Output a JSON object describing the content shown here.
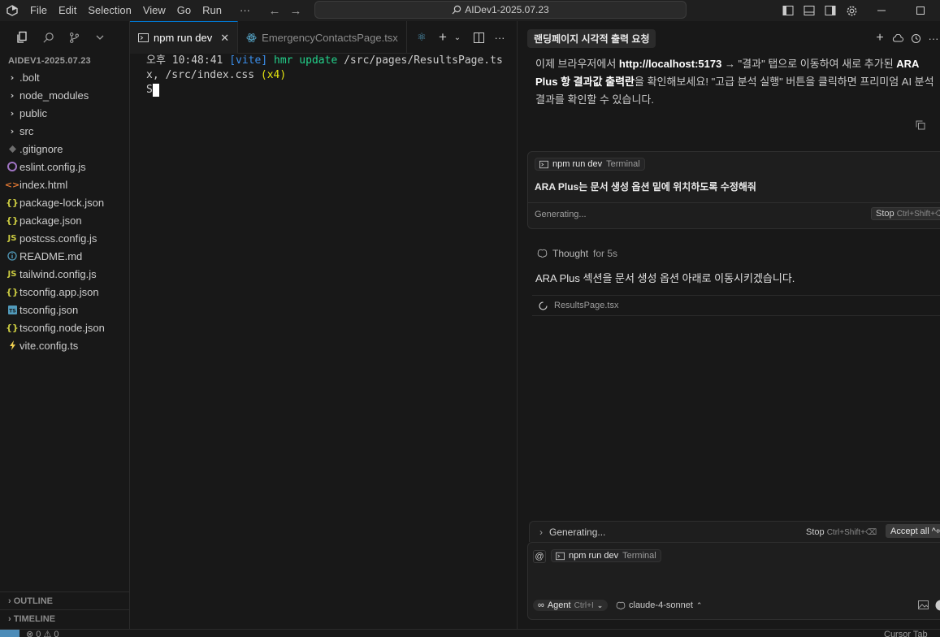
{
  "titlebar": {
    "menus": [
      "File",
      "Edit",
      "Selection",
      "View",
      "Go",
      "Run",
      "···"
    ],
    "search_text": "AIDev1-2025.07.23"
  },
  "explorer": {
    "title": "AIDEV1-2025.07.23",
    "items": [
      {
        "label": ".bolt",
        "icon": "chevron",
        "color": "#cccccc"
      },
      {
        "label": "node_modules",
        "icon": "chevron",
        "color": "#cccccc"
      },
      {
        "label": "public",
        "icon": "chevron",
        "color": "#cccccc"
      },
      {
        "label": "src",
        "icon": "chevron",
        "color": "#cccccc"
      },
      {
        "label": ".gitignore",
        "icon": "git-diamond",
        "color": "#6d6d6d"
      },
      {
        "label": "eslint.config.js",
        "icon": "eslint-circle",
        "color": "#a074c4"
      },
      {
        "label": "index.html",
        "icon": "html-brackets",
        "color": "#e37933"
      },
      {
        "label": "package-lock.json",
        "icon": "json-braces",
        "color": "#cbcb41"
      },
      {
        "label": "package.json",
        "icon": "json-braces",
        "color": "#cbcb41"
      },
      {
        "label": "postcss.config.js",
        "icon": "js-text",
        "color": "#cbcb41"
      },
      {
        "label": "README.md",
        "icon": "info-circle",
        "color": "#519aba"
      },
      {
        "label": "tailwind.config.js",
        "icon": "js-text",
        "color": "#cbcb41"
      },
      {
        "label": "tsconfig.app.json",
        "icon": "json-braces",
        "color": "#cbcb41"
      },
      {
        "label": "tsconfig.json",
        "icon": "ts-square",
        "color": "#519aba"
      },
      {
        "label": "tsconfig.node.json",
        "icon": "json-braces",
        "color": "#cbcb41"
      },
      {
        "label": "vite.config.ts",
        "icon": "vite-bolt",
        "color": "#f0d050"
      }
    ],
    "outline_label": "OUTLINE",
    "timeline_label": "TIMELINE"
  },
  "editor": {
    "tabs": [
      {
        "label": "npm run dev",
        "active": true
      },
      {
        "label": "EmergencyContactsPage.tsx",
        "active": false
      }
    ],
    "terminal": {
      "time": "오후 10:48:41",
      "vite": "[vite]",
      "hmr": "hmr update",
      "path": "/src/pages/ResultsPage.tsx, /src/index.css",
      "count": "(x4)",
      "input_char": "S"
    }
  },
  "chat": {
    "title": "랜딩페이지 시각적 출력 요청",
    "message": {
      "part1": "이제 브라우저에서 ",
      "url": "http://localhost:5173",
      "part2": " → \"결과\" 탭으로 이동하여 새로 추가된 ",
      "bold2": "ARA Plus 항 결과값 출력란",
      "part3": "을 확인해보세요! \"고급 분석 실행\" 버튼을 클릭하면 프리미엄 AI 분석 결과를 확인할 수 있습니다."
    },
    "tool_card": {
      "chip_label": "npm run dev",
      "chip_sub": "Terminal",
      "instruction": "ARA Plus는 문서 생성 옵션 밑에 위치하도록 수정해줘",
      "status": "Generating...",
      "stop_label": "Stop",
      "stop_kbd": "Ctrl+Shift+⌫"
    },
    "thought": {
      "label": "Thought",
      "duration": "for 5s"
    },
    "reply": "ARA Plus 섹션을 문서 생성 옵션 아래로 이동시키겠습니다.",
    "file_row": "ResultsPage.tsx",
    "gen_bar": {
      "status": "Generating...",
      "stop_label": "Stop",
      "stop_kbd": "Ctrl+Shift+⌫",
      "accept_label": "Accept all",
      "accept_kbd": "^⏎"
    },
    "composer": {
      "at": "@",
      "chip_label": "npm run dev",
      "chip_sub": "Terminal",
      "agent_label": "Agent",
      "agent_kbd": "Ctrl+I",
      "model": "claude-4-sonnet"
    }
  },
  "statusbar": {
    "problems": "⊗ 0 ⚠ 0",
    "right_text": "Cursor Tab"
  },
  "colors": {
    "accent": "#0078d4",
    "background": "#181818"
  }
}
